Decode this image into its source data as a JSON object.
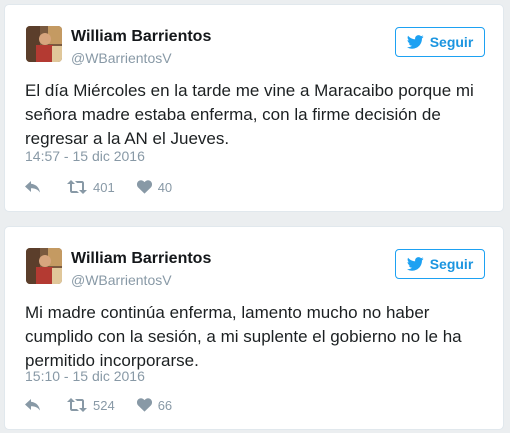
{
  "tweets": [
    {
      "author_name": "William Barrientos",
      "author_handle": "@WBarrientosV",
      "follow_label": "Seguir",
      "text": "El día Miércoles en la tarde me vine a Maracaibo porque mi señora madre estaba enferma, con la firme decisión de regresar a la AN el Jueves.",
      "timestamp": "14:57 - 15 dic 2016",
      "retweets": "401",
      "likes": "40"
    },
    {
      "author_name": "William Barrientos",
      "author_handle": "@WBarrientosV",
      "follow_label": "Seguir",
      "text": "Mi madre continúa enferma, lamento mucho no haber cumplido con la sesión, a mi suplente el gobierno no le ha permitido incorporarse.",
      "timestamp": "15:10 - 15 dic 2016",
      "retweets": "524",
      "likes": "66"
    }
  ],
  "icons": {
    "follow": "twitter-bird-icon",
    "reply": "reply-icon",
    "retweet": "retweet-icon",
    "like": "heart-icon"
  },
  "colors": {
    "accent": "#1da1f2",
    "muted": "#8899a6",
    "text": "#1c2022",
    "background": "#ebeef0"
  }
}
